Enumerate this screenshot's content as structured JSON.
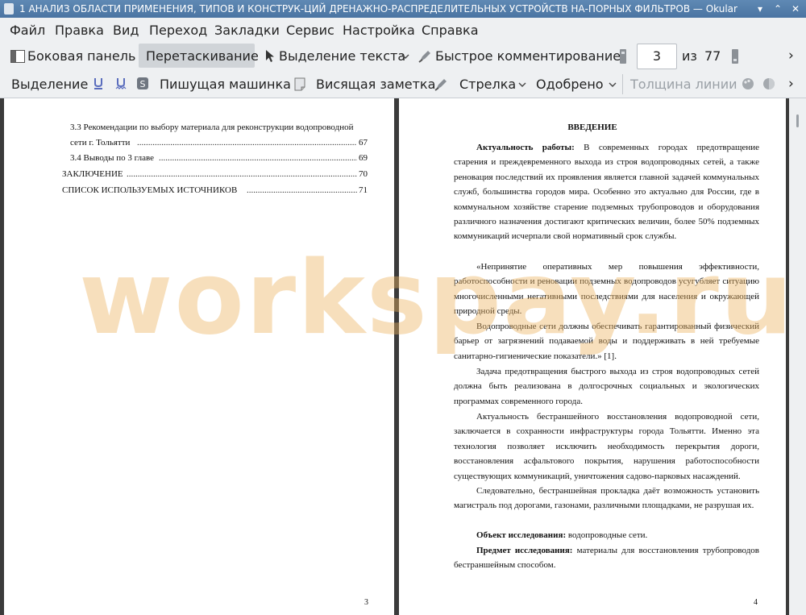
{
  "window": {
    "title": "1 АНАЛИЗ ОБЛАСТИ ПРИМЕНЕНИЯ, ТИПОВ И КОНСТРУК-ЦИЙ ДРЕНАЖНО-РАСПРЕДЕЛИТЕЛЬНЫХ УСТРОЙСТВ НА-ПОРНЫХ ФИЛЬТРОВ — Okular",
    "min_glyph": "▾",
    "max_glyph": "⌃",
    "close_glyph": "✕"
  },
  "menu": [
    "Файл",
    "Правка",
    "Вид",
    "Переход",
    "Закладки",
    "Сервис",
    "Настройка",
    "Справка"
  ],
  "toolbar": {
    "sidebar_label": "Боковая панель",
    "drag_label": "Перетаскивание",
    "text_select_label": "Выделение текста",
    "quick_comment_label": "Быстрое комментирование",
    "page_current": "3",
    "page_of_label": "из",
    "page_total": "77",
    "more_glyph": "›"
  },
  "annotation_toolbar": {
    "selection_label": "Выделение",
    "typewriter_label": "Пишущая машинка",
    "hanging_note_label": "Висящая заметка",
    "arrow_label": "Стрелка",
    "approved_label": "Одобрено",
    "line_width_label": "Толщина линии",
    "more_glyph": "›"
  },
  "left_page": {
    "toc": [
      {
        "label": "3.3 Рекомендации по выбору материала для реконструкции водопроводной",
        "page": ""
      },
      {
        "label": "сети г. Тольятти",
        "page": "67"
      },
      {
        "label": "3.4 Выводы по 3 главе",
        "page": "69"
      },
      {
        "label": "ЗАКЛЮЧЕНИЕ",
        "page": "70"
      },
      {
        "label": "СПИСОК ИСПОЛЬЗУЕМЫХ ИСТОЧНИКОВ",
        "page": "71"
      }
    ],
    "page_number": "3"
  },
  "right_page": {
    "heading": "ВВЕДЕНИЕ",
    "p1_bold": "Актуальность работы:",
    "p1_text": " В современных городах предотвращение старения и преждевременного выхода из строя водопроводных сетей, а также реновация последствий их проявления является главной задачей коммунальных служб, большинства городов мира. Особенно это актуально для России, где в коммунальном хозяйстве старение подземных трубопроводов и оборудования различного назначения достигают критических величин, более 50% подземных коммуникаций исчерпали свой нормативный срок службы.",
    "p2": "«Непринятие оперативных мер повышения эффективности, работоспособности и реновации подземных водопроводов усугубляет ситуацию многочисленными негативными последствиями для населения и окружающей природной среды.",
    "p3": "Водопроводные сети должны обеспечивать гарантированный физический барьер от загрязнений подаваемой воды и поддерживать в ней требуемые санитарно-гигиенические показатели.» [1].",
    "p4": "Задача предотвращения быстрого выхода из строя водопроводных сетей должна быть реализована в долгосрочных социальных и экологических программах современного города.",
    "p5": "Актуальность бестраншейного восстановления водопроводной сети, заключается в сохранности инфраструктуры города Тольятти. Именно эта технология позволяет исключить необходимость перекрытия дороги, восстановления асфальтового покрытия, нарушения работоспособности существующих коммуникаций, уничтожения садово-парковых насаждений.",
    "p6": "Следовательно, бестраншейная прокладка даёт возможность установить магистраль под дорогами, газонами, различными площадками, не разрушая их.",
    "p7_bold": "Объект исследования:",
    "p7_text": " водопроводные сети.",
    "p8_bold": "Предмет исследования:",
    "p8_text": " материалы для восстановления трубопроводов бестраншейным способом.",
    "page_number": "4"
  },
  "watermark": "workspay.ru"
}
